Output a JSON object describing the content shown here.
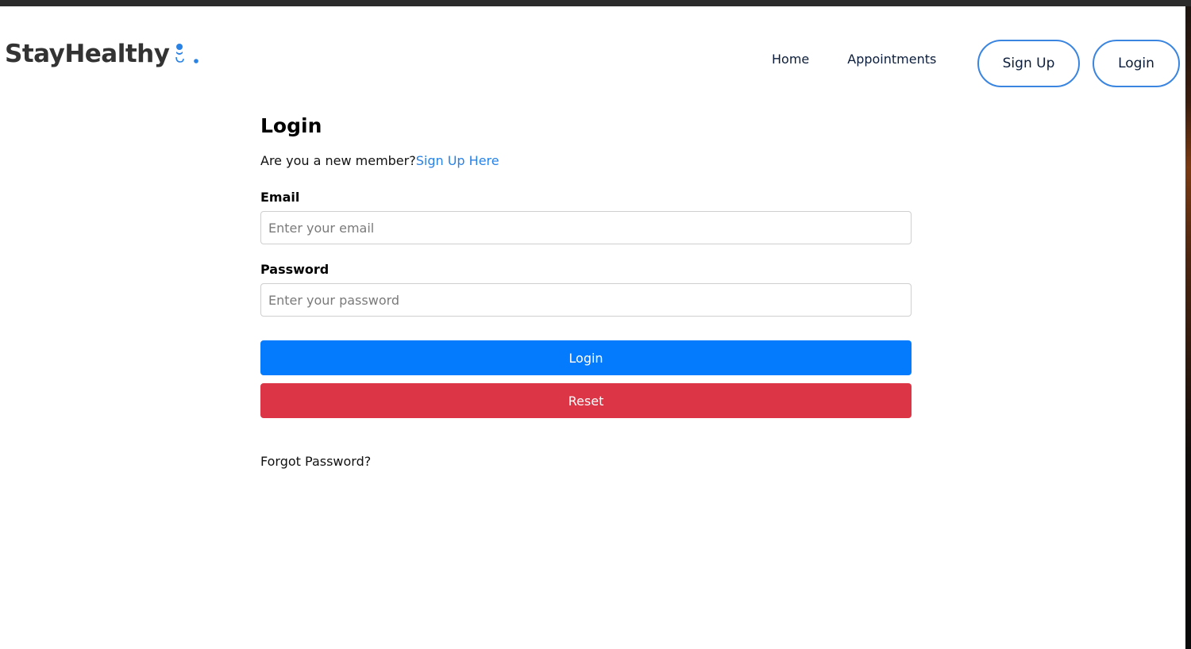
{
  "brand": {
    "name": "StayHealthy",
    "icon": "doctor-stethoscope-icon",
    "accent_color": "#2a82e4"
  },
  "nav": {
    "links": [
      {
        "label": "Home"
      },
      {
        "label": "Appointments"
      }
    ],
    "signup_label": "Sign Up",
    "login_label": "Login",
    "button_border_color": "#3a85e0"
  },
  "form": {
    "title": "Login",
    "member_prompt": "Are you a new member?",
    "signup_link": "Sign Up Here",
    "email": {
      "label": "Email",
      "placeholder": "Enter your email",
      "value": ""
    },
    "password": {
      "label": "Password",
      "placeholder": "Enter your password",
      "value": ""
    },
    "login_button": "Login",
    "reset_button": "Reset",
    "forgot_password": "Forgot Password?",
    "login_color": "#037bfc",
    "reset_color": "#dc3545"
  }
}
